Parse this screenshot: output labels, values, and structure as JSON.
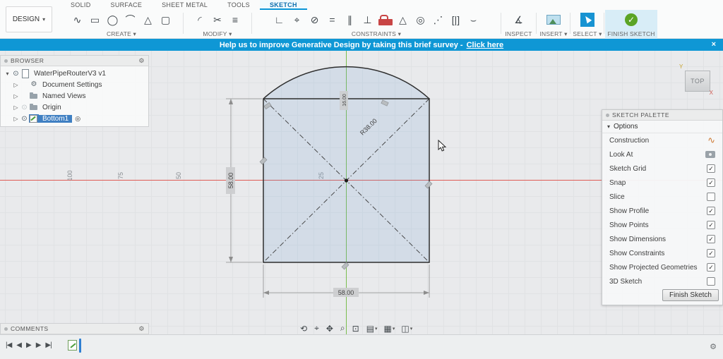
{
  "app_menu": {
    "design_label": "DESIGN",
    "caret": "▾"
  },
  "tabs": [
    {
      "name": "tab-solid",
      "label": "SOLID"
    },
    {
      "name": "tab-surface",
      "label": "SURFACE"
    },
    {
      "name": "tab-sheet-metal",
      "label": "SHEET METAL"
    },
    {
      "name": "tab-tools",
      "label": "TOOLS"
    },
    {
      "name": "tab-sketch",
      "label": "SKETCH",
      "active": true
    }
  ],
  "toolbar": {
    "groups": [
      {
        "label": "CREATE ▾",
        "tools": [
          {
            "name": "line-tool",
            "glyph": "∿"
          },
          {
            "name": "rectangle-tool",
            "glyph": "▭"
          },
          {
            "name": "circle-tool",
            "glyph": "◯"
          },
          {
            "name": "arc-tool",
            "glyph": "⌒"
          },
          {
            "name": "polygon-tool",
            "glyph": "△"
          },
          {
            "name": "slot-tool",
            "glyph": "▢"
          }
        ]
      },
      {
        "label": "MODIFY ▾",
        "tools": [
          {
            "name": "fillet-tool",
            "glyph": "◜"
          },
          {
            "name": "trim-tool",
            "glyph": "✂"
          },
          {
            "name": "offset-tool",
            "glyph": "≡"
          }
        ]
      },
      {
        "label": "CONSTRAINTS ▾",
        "tools": [
          {
            "name": "horizontal-vertical-constraint",
            "glyph": "∟"
          },
          {
            "name": "coincident-constraint",
            "glyph": "⌖"
          },
          {
            "name": "tangent-constraint",
            "glyph": "⊘"
          },
          {
            "name": "equal-constraint",
            "glyph": "="
          },
          {
            "name": "parallel-constraint",
            "glyph": "∥"
          },
          {
            "name": "perpendicular-constraint",
            "glyph": "⊥"
          },
          {
            "name": "fix-unfix-constraint",
            "glyph": "",
            "lock": true
          },
          {
            "name": "midpoint-constraint",
            "glyph": "△"
          },
          {
            "name": "concentric-constraint",
            "glyph": "◎"
          },
          {
            "name": "collinear-constraint",
            "glyph": "⋰"
          },
          {
            "name": "symmetry-constraint",
            "glyph": "[|]"
          },
          {
            "name": "curvature-constraint",
            "glyph": "⌣"
          }
        ]
      },
      {
        "label": "INSPECT ▾",
        "tools": [
          {
            "name": "measure-tool",
            "glyph": "∡"
          }
        ]
      },
      {
        "label": "INSERT ▾",
        "tools": [
          {
            "name": "insert-image-tool",
            "glyph": "",
            "img": true
          }
        ]
      },
      {
        "label": "SELECT ▾",
        "tools": [
          {
            "name": "select-tool",
            "glyph": "",
            "select": true
          }
        ]
      },
      {
        "label": "FINISH SKETCH ▾",
        "tools": [
          {
            "name": "finish-sketch-button",
            "glyph": "✓",
            "check": true
          }
        ]
      }
    ]
  },
  "banner": {
    "text": "Help us to improve Generative Design by taking this brief survey -",
    "link_label": "Click here",
    "close_glyph": "×"
  },
  "browser": {
    "title": "BROWSER",
    "items": [
      {
        "name": "browser-item-root",
        "label": "WaterPipeRouterV3 v1",
        "caret": "▾",
        "eye": "⊙",
        "icon": "document-icon"
      },
      {
        "name": "browser-item-document-settings",
        "label": "Document Settings",
        "caret": "▷",
        "icon": "settings-gear-icon",
        "icon_glyph": "⚙",
        "indent": true
      },
      {
        "name": "browser-item-named-views",
        "label": "Named Views",
        "caret": "▷",
        "icon": "folder-icon",
        "indent": true
      },
      {
        "name": "browser-item-origin",
        "label": "Origin",
        "caret": "▷",
        "eye": "⊙",
        "eye_dim": true,
        "icon": "folder-icon",
        "indent": true
      },
      {
        "name": "browser-item-bottom1",
        "label": "Bottom1",
        "caret": "▷",
        "eye": "⊙",
        "icon": "sketch-icon",
        "selected": true,
        "radio": "◎",
        "indent": true
      }
    ]
  },
  "viewcube": {
    "face": "TOP",
    "axis_x": "X",
    "axis_y": "Y"
  },
  "sketch": {
    "dim_width": "58.00",
    "dim_height": "58.00",
    "dim_radius": "R38.00",
    "dim_top": "16.00",
    "ruler_labels": [
      "100",
      "75",
      "50",
      "25"
    ]
  },
  "palette": {
    "title": "SKETCH PALETTE",
    "section_caret": "▾",
    "section": "Options",
    "options": [
      {
        "name": "construction-icon",
        "label": "Construction",
        "control": "construction-icon",
        "glyph": "∿"
      },
      {
        "name": "look-at-icon",
        "label": "Look At",
        "control": "look-at-icon",
        "glyph": ""
      },
      {
        "name": "sketch-grid-checkbox",
        "label": "Sketch Grid",
        "control": "checkbox",
        "glyph": "✓",
        "checked": true
      },
      {
        "name": "snap-checkbox",
        "label": "Snap",
        "control": "checkbox",
        "glyph": "✓",
        "checked": true
      },
      {
        "name": "slice-checkbox",
        "label": "Slice",
        "control": "checkbox",
        "glyph": "",
        "checked": false
      },
      {
        "name": "show-profile-checkbox",
        "label": "Show Profile",
        "control": "checkbox",
        "glyph": "✓",
        "checked": true
      },
      {
        "name": "show-points-checkbox",
        "label": "Show Points",
        "control": "checkbox",
        "glyph": "✓",
        "checked": true
      },
      {
        "name": "show-dimensions-checkbox",
        "label": "Show Dimensions",
        "control": "checkbox",
        "glyph": "✓",
        "checked": true
      },
      {
        "name": "show-constraints-checkbox",
        "label": "Show Constraints",
        "control": "checkbox",
        "glyph": "✓",
        "checked": true
      },
      {
        "name": "show-projected-geometries-checkbox",
        "label": "Show Projected Geometries",
        "control": "checkbox",
        "glyph": "✓",
        "checked": true
      },
      {
        "name": "3d-sketch-checkbox",
        "label": "3D Sketch",
        "control": "checkbox",
        "glyph": "",
        "checked": false
      }
    ],
    "finish_button": "Finish Sketch"
  },
  "comments": {
    "title": "COMMENTS"
  },
  "navbar": {
    "tools": [
      {
        "name": "orbit-tool",
        "glyph": "⟲"
      },
      {
        "name": "look-at-tool",
        "glyph": "⌖"
      },
      {
        "name": "pan-tool",
        "glyph": "✥"
      },
      {
        "name": "zoom-tool",
        "glyph": "⌕"
      },
      {
        "name": "fit-tool",
        "glyph": "⊡"
      },
      {
        "name": "display-settings-menu",
        "glyph": "▤",
        "caret": "▾"
      },
      {
        "name": "grid-and-snaps-menu",
        "glyph": "▦",
        "caret": "▾"
      },
      {
        "name": "viewports-menu",
        "glyph": "◫",
        "caret": "▾"
      }
    ]
  },
  "timeline": {
    "controls": [
      {
        "name": "go-to-start-button",
        "glyph": "|◀"
      },
      {
        "name": "step-back-button",
        "glyph": "◀"
      },
      {
        "name": "play-button",
        "glyph": "▶"
      },
      {
        "name": "step-forward-button",
        "glyph": "▶"
      },
      {
        "name": "go-to-end-button",
        "glyph": "▶|"
      }
    ]
  },
  "icons": {
    "gear": "⚙"
  }
}
